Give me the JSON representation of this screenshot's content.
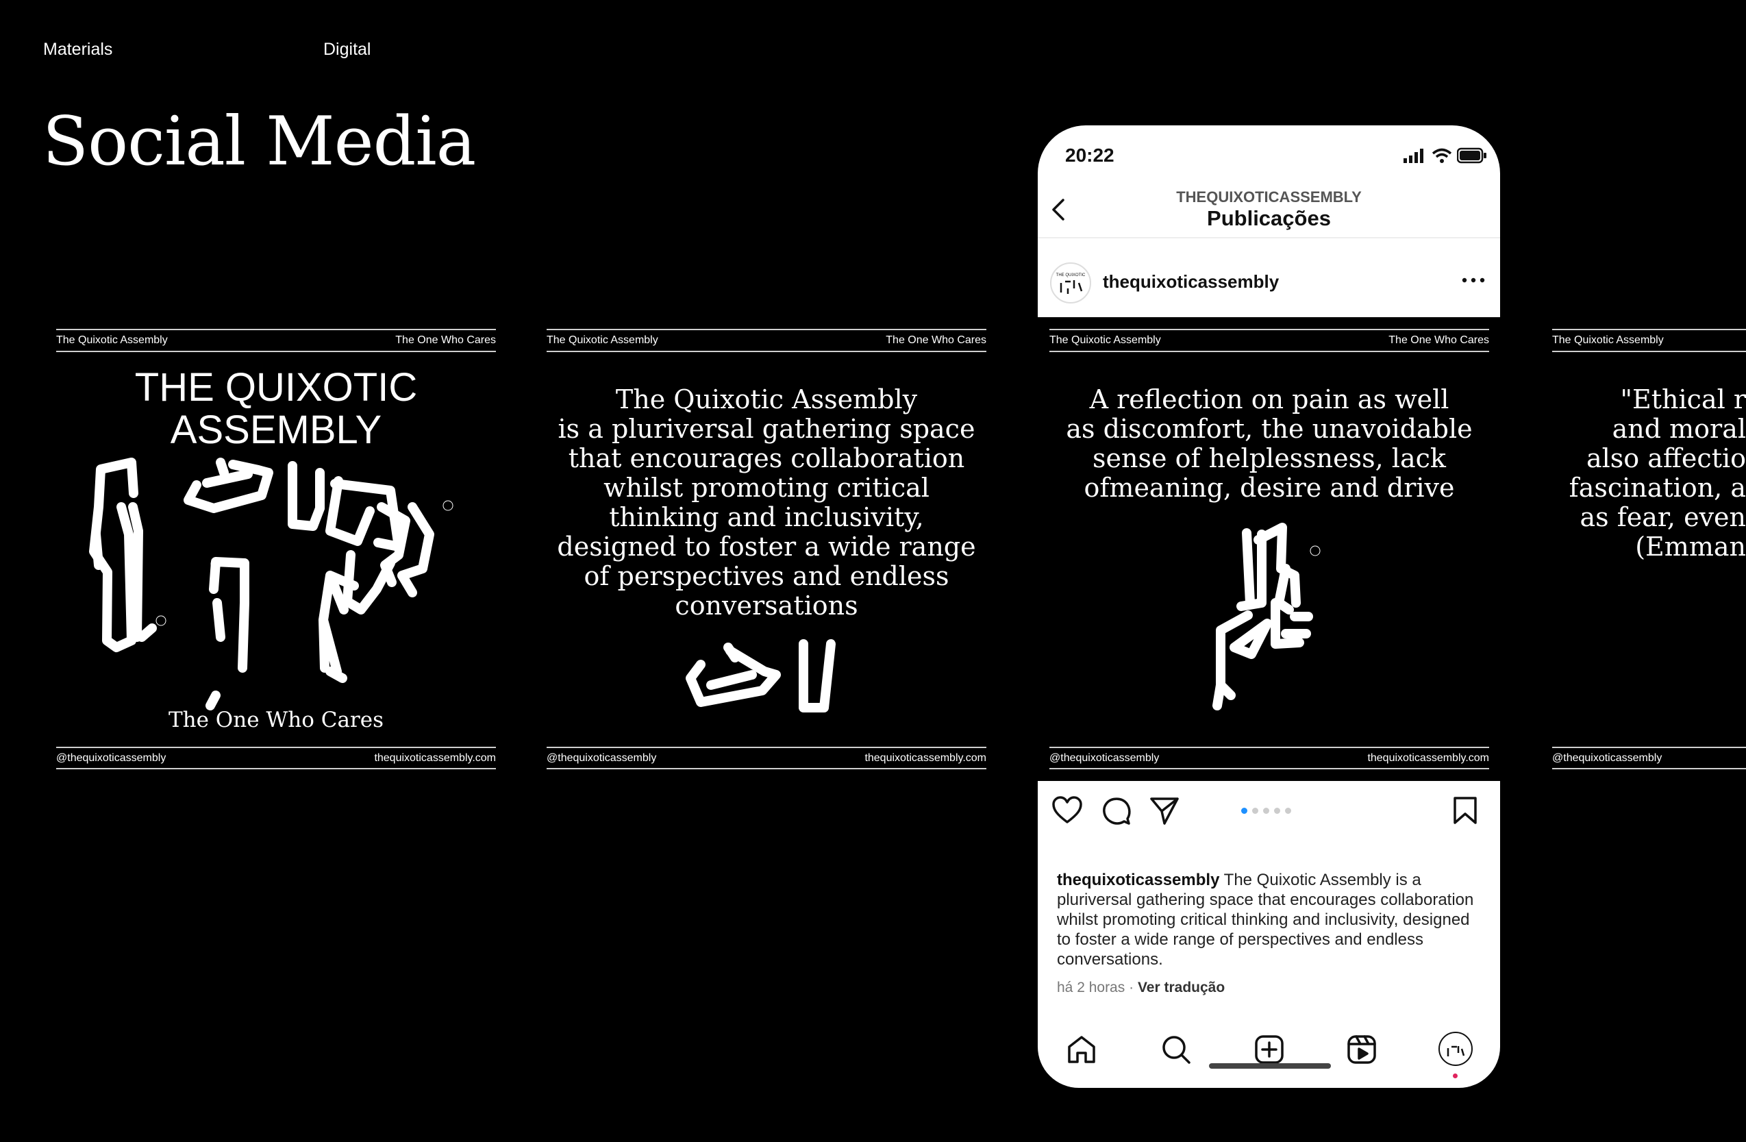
{
  "header": {
    "section": "Materials",
    "subsection": "Digital",
    "title": "Social Media"
  },
  "post_common": {
    "top_left": "The Quixotic Assembly",
    "top_right": "The One Who Cares",
    "bottom_left": "@thequixoticassembly",
    "bottom_right": "thequixoticassembly.com"
  },
  "post1": {
    "title": "THE QUIXOTIC\nASSEMBLY",
    "subtitle": "The One Who Cares"
  },
  "post2": {
    "text": "The Quixotic Assembly\nis a pluriversal gathering space\nthat encourages collaboration\nwhilst promoting critical\nthinking and inclusivity,\ndesigned to foster a wide range\nof perspectives and endless\nconversations"
  },
  "post3": {
    "text": "A reflection on pain as well\nas discomfort, the unavoidable\nsense of helplessness, lack\nofmeaning, desire and drive"
  },
  "post4": {
    "text": "\"Ethical r\nand moral\nalso affectio\nfascination, a\nas fear, even\n(Emman"
  },
  "phone": {
    "status_time": "20:22",
    "account_header": "THEQUIXOTICASSEMBLY",
    "screen_title": "Publicações",
    "username": "thequixoticassembly",
    "caption_user": "thequixoticassembly",
    "caption_text": "The Quixotic Assembly is a pluriversal gathering space that encourages collaboration whilst promoting critical thinking and inclusivity, designed to foster a wide range of perspectives and endless conversations.",
    "time_ago": "há 2 horas",
    "separator": "·",
    "translate": "Ver tradução",
    "carousel": {
      "total": 5,
      "active": 1
    }
  },
  "colors": {
    "background": "#000000",
    "text": "#ffffff",
    "accent_blue": "#1e90ff",
    "notification_red": "#e0245e"
  },
  "icons": [
    "back-icon",
    "more-icon",
    "heart-icon",
    "comment-icon",
    "share-icon",
    "bookmark-icon",
    "home-icon",
    "search-icon",
    "add-icon",
    "reels-icon",
    "profile-icon",
    "signal-icon",
    "wifi-icon",
    "battery-icon"
  ]
}
